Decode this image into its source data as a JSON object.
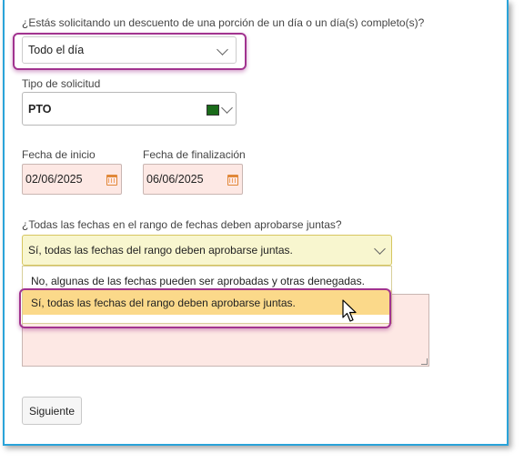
{
  "question_portion": "¿Estás solicitando un descuento de una porción de un día o un día(s) completo(s)?",
  "portion_select": {
    "value": "Todo el día"
  },
  "request_type": {
    "label": "Tipo de solicitud",
    "value": "PTO",
    "color": "#1a6b1a"
  },
  "start_date": {
    "label": "Fecha de inicio",
    "value": "02/06/2025"
  },
  "end_date": {
    "label": "Fecha de finalización",
    "value": "06/06/2025"
  },
  "approve_together": {
    "question": "¿Todas las fechas en el rango de fechas deben aprobarse juntas?",
    "value": "Sí, todas las fechas del rango deben aprobarse juntas.",
    "options": [
      "No, algunas de las fechas pueden ser aprobadas y otras denegadas.",
      "Sí, todas las fechas del rango deben aprobarse juntas."
    ]
  },
  "next_button": "Siguiente",
  "colors": {
    "highlight": "#a1338f",
    "frame": "#2aa3d9",
    "option_hover": "#fbd98a"
  }
}
